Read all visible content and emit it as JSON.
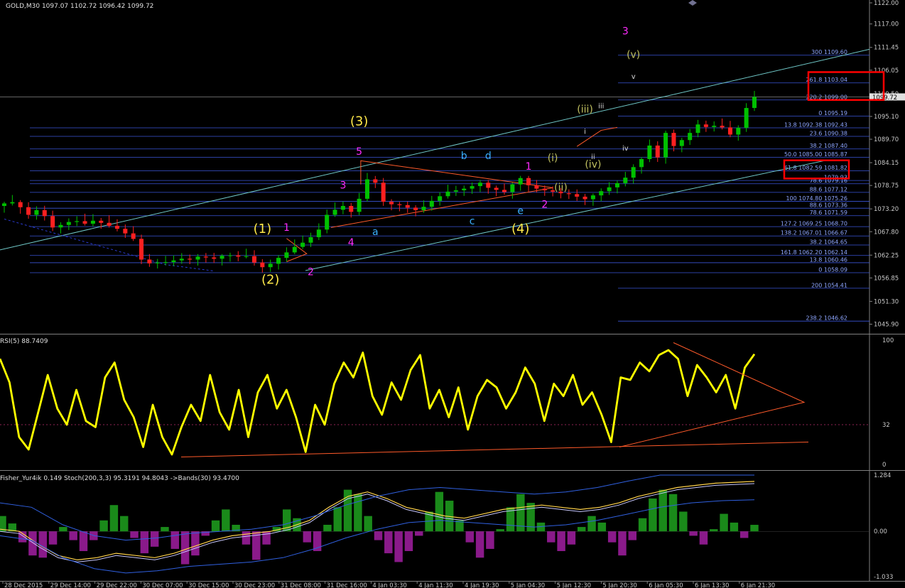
{
  "window": {
    "symbol_header": "GOLD,M30  1097.07 1102.72 1096.42 1099.72"
  },
  "colors": {
    "background": "#000000",
    "grid": "#1e2a55",
    "axis_text": "#c8c8c8",
    "candle_up": "#00c000",
    "candle_down": "#ff2020",
    "fib_line": "#3a55d8",
    "fib_text": "#8ea6ff",
    "channel": "#6fc7c7",
    "triangle": "#ff5a2a",
    "yellow": "#ffe84a",
    "magenta": "#ff2bff",
    "cyan": "#3ab0ff",
    "olive": "#c0c060",
    "white": "#d8d8d8",
    "red_box": "#ff0000",
    "rsi_line": "#ffff00",
    "hist_up": "#1a8a1a",
    "hist_down": "#8a1a8a",
    "stoch_main": "#ffd24a",
    "stoch_signal": "#c8c8ff",
    "bands": "#3060e0"
  },
  "chart_data": [
    {
      "type": "candlestick",
      "title": "GOLD,M30",
      "ohlc_header": {
        "open": 1097.07,
        "high": 1102.72,
        "low": 1096.42,
        "close": 1099.72
      },
      "ylim": [
        1044.3,
        1122.0
      ],
      "y_ticks": [
        1122.0,
        1117.0,
        1111.45,
        1106.05,
        1100.5,
        1095.1,
        1089.7,
        1084.15,
        1078.75,
        1073.2,
        1067.8,
        1062.25,
        1056.85,
        1051.3,
        1045.9
      ],
      "y_tick_labels": [
        "1122.00",
        "1117.00",
        "1111.45",
        "1106.05",
        "1100.50",
        "1095.10",
        "1089.70",
        "1084.15",
        "1078.75",
        "1073.20",
        "1067.80",
        "1062.25",
        "1056.85",
        "1051.30",
        "1045.90"
      ],
      "current_price_label": "1099.72",
      "x_tick_labels": [
        "28 Dec 2015",
        "29 Dec 14:00",
        "29 Dec 22:00",
        "30 Dec 07:00",
        "30 Dec 15:00",
        "30 Dec 23:00",
        "31 Dec 08:00",
        "31 Dec 16:00",
        "4 Jan 03:30",
        "4 Jan 11:30",
        "4 Jan 19:30",
        "5 Jan 04:30",
        "5 Jan 12:30",
        "5 Jan 20:30",
        "6 Jan 05:30",
        "6 Jan 13:30",
        "6 Jan 21:30"
      ],
      "close_path": [
        1074.5,
        1074.8,
        1073.6,
        1071.8,
        1072.9,
        1071.5,
        1068.8,
        1069.4,
        1070.1,
        1070.3,
        1069.7,
        1070.4,
        1069.9,
        1069.2,
        1068.5,
        1067.4,
        1066.1,
        1061.2,
        1060.3,
        1060.5,
        1060.6,
        1061.0,
        1061.4,
        1061.2,
        1061.9,
        1061.7,
        1061.4,
        1062.1,
        1062.2,
        1061.9,
        1062.0,
        1060.5,
        1059.4,
        1060.2,
        1061.6,
        1062.9,
        1064.2,
        1065.2,
        1066.5,
        1068.3,
        1071.8,
        1073.0,
        1073.9,
        1072.5,
        1075.6,
        1080.2,
        1079.4,
        1074.9,
        1074.3,
        1074.1,
        1073.5,
        1072.9,
        1073.7,
        1075.1,
        1076.2,
        1077.3,
        1077.6,
        1078.0,
        1078.6,
        1079.4,
        1078.2,
        1077.7,
        1077.2,
        1079.0,
        1080.5,
        1078.8,
        1078.0,
        1077.6,
        1077.3,
        1076.9,
        1076.7,
        1076.1,
        1075.5,
        1076.4,
        1077.4,
        1078.3,
        1079.3,
        1080.6,
        1083.1,
        1085.0,
        1088.2,
        1085.4,
        1091.2,
        1088.1,
        1089.5,
        1091.2,
        1093.2,
        1092.6,
        1092.9,
        1092.5,
        1090.8,
        1092.4,
        1097.1,
        1099.72
      ],
      "fib_levels": [
        {
          "label": "300 1109.60",
          "value": 1109.6
        },
        {
          "label": "261.8 1103.04",
          "value": 1103.04
        },
        {
          "label": "220.2 1099.00",
          "value": 1099.0
        },
        {
          "label": "0 1095.19",
          "value": 1095.19
        },
        {
          "label": "13.8 1092.38 1092.43",
          "value": 1092.4
        },
        {
          "label": "23.6 1090.38",
          "value": 1090.38
        },
        {
          "label": "38.2 1087.40",
          "value": 1087.4
        },
        {
          "label": "50.0 1085.00 1085.87",
          "value": 1085.4
        },
        {
          "label": "61.8 1082.59 1081.82",
          "value": 1082.2
        },
        {
          "label": "1079.93",
          "value": 1079.93
        },
        {
          "label": "78.6 1079.16",
          "value": 1079.16
        },
        {
          "label": "88.6 1077.12",
          "value": 1077.12
        },
        {
          "label": "100 1074.80 1075.26",
          "value": 1075.0
        },
        {
          "label": "88.6 1073.36",
          "value": 1073.36
        },
        {
          "label": "78.6 1071.59",
          "value": 1071.59
        },
        {
          "label": "127.2 1069.25 1068.70",
          "value": 1069.0
        },
        {
          "label": "138.2 1067.01 1066.67",
          "value": 1066.8
        },
        {
          "label": "38.2 1064.65",
          "value": 1064.65
        },
        {
          "label": "161.8 1062.20 1062.14",
          "value": 1062.17
        },
        {
          "label": "13.8 1060.46",
          "value": 1060.46
        },
        {
          "label": "0 1058.09",
          "value": 1058.09
        },
        {
          "label": "200 1054.41",
          "value": 1054.41
        },
        {
          "label": "238.2 1046.62",
          "value": 1046.62
        }
      ],
      "wave_labels": [
        {
          "text": "(1)",
          "color": "yellow",
          "i": 32,
          "price": 1067.5
        },
        {
          "text": "(2)",
          "color": "yellow",
          "i": 33,
          "price": 1055.5
        },
        {
          "text": "(3)",
          "color": "yellow",
          "i": 44,
          "price": 1093.0
        },
        {
          "text": "(4)",
          "color": "yellow",
          "i": 64,
          "price": 1067.5
        },
        {
          "text": "1",
          "color": "magenta",
          "i": 35,
          "price": 1068.0
        },
        {
          "text": "2",
          "color": "magenta",
          "i": 38,
          "price": 1057.5
        },
        {
          "text": "3",
          "color": "magenta",
          "i": 42,
          "price": 1078.0
        },
        {
          "text": "4",
          "color": "magenta",
          "i": 43,
          "price": 1064.5
        },
        {
          "text": "5",
          "color": "magenta",
          "i": 44,
          "price": 1086.0
        },
        {
          "text": "1",
          "color": "magenta",
          "i": 65,
          "price": 1082.5
        },
        {
          "text": "2",
          "color": "magenta",
          "i": 67,
          "price": 1073.5
        },
        {
          "text": "3",
          "color": "magenta",
          "i": 77,
          "price": 1114.5
        },
        {
          "text": "a",
          "color": "cyan",
          "i": 46,
          "price": 1067.0
        },
        {
          "text": "b",
          "color": "cyan",
          "i": 57,
          "price": 1085.0
        },
        {
          "text": "c",
          "color": "cyan",
          "i": 58,
          "price": 1069.5
        },
        {
          "text": "d",
          "color": "cyan",
          "i": 60,
          "price": 1085.0
        },
        {
          "text": "e",
          "color": "cyan",
          "i": 64,
          "price": 1072.0
        },
        {
          "text": "(i)",
          "color": "olive",
          "i": 68,
          "price": 1084.5
        },
        {
          "text": "(ii)",
          "color": "olive",
          "i": 69,
          "price": 1077.5
        },
        {
          "text": "(iii)",
          "color": "olive",
          "i": 72,
          "price": 1096.0
        },
        {
          "text": "(iv)",
          "color": "olive",
          "i": 73,
          "price": 1083.0
        },
        {
          "text": "(v)",
          "color": "olive",
          "i": 78,
          "price": 1109.0
        },
        {
          "text": "i",
          "color": "white",
          "i": 72,
          "price": 1091.0
        },
        {
          "text": "ii",
          "color": "white",
          "i": 73,
          "price": 1085.0
        },
        {
          "text": "iii",
          "color": "white",
          "i": 74,
          "price": 1097.0
        },
        {
          "text": "iv",
          "color": "white",
          "i": 77,
          "price": 1087.0
        },
        {
          "text": "v",
          "color": "white",
          "i": 78,
          "price": 1104.0
        }
      ]
    },
    {
      "type": "line",
      "title": "RSI(5) 88.7409",
      "ylim": [
        0,
        100
      ],
      "y_ticks": [
        100,
        32,
        0
      ],
      "y_tick_labels": [
        "100",
        "32",
        "0"
      ],
      "level": 32,
      "values": [
        85,
        66,
        22,
        12,
        42,
        72,
        45,
        32,
        60,
        35,
        30,
        70,
        82,
        52,
        38,
        14,
        48,
        22,
        8,
        30,
        48,
        35,
        72,
        42,
        28,
        60,
        22,
        58,
        72,
        45,
        60,
        38,
        10,
        48,
        32,
        65,
        82,
        70,
        90,
        55,
        40,
        66,
        52,
        76,
        88,
        45,
        60,
        38,
        62,
        28,
        55,
        68,
        62,
        45,
        58,
        78,
        65,
        35,
        65,
        55,
        72,
        48,
        58,
        40,
        18,
        70,
        68,
        82,
        75,
        88,
        92,
        85,
        55,
        80,
        70,
        58,
        72,
        45,
        78,
        88.74
      ]
    },
    {
      "type": "bar",
      "title": "Fisher_Yur4ik 0.149  Stoch(200,3,3) 95.3191 94.8043  ->Bands(30) 93.4700",
      "ylim": [
        -1.033,
        1.284
      ],
      "y_ticks": [
        1.284,
        0.0,
        -1.033
      ],
      "y_tick_labels": [
        "1.284",
        "0.00",
        "-1.033"
      ],
      "values": [
        0.35,
        0.18,
        -0.25,
        -0.55,
        -0.6,
        -0.3,
        0.1,
        -0.2,
        -0.45,
        -0.2,
        0.25,
        0.6,
        0.35,
        -0.15,
        -0.5,
        -0.35,
        0.1,
        -0.4,
        -0.75,
        -0.55,
        -0.1,
        0.25,
        0.5,
        0.15,
        -0.3,
        -0.65,
        -0.3,
        0.1,
        0.5,
        0.3,
        -0.25,
        -0.45,
        0.15,
        0.55,
        0.95,
        0.85,
        0.35,
        -0.2,
        -0.5,
        -0.7,
        -0.45,
        -0.1,
        0.45,
        0.9,
        0.7,
        0.25,
        -0.25,
        -0.6,
        -0.4,
        0.05,
        0.55,
        0.85,
        0.65,
        0.2,
        -0.25,
        -0.45,
        -0.3,
        0.1,
        0.35,
        0.2,
        -0.25,
        -0.55,
        -0.2,
        0.3,
        0.75,
        0.95,
        0.85,
        0.45,
        -0.1,
        -0.3,
        0.05,
        0.4,
        0.2,
        -0.15,
        0.149
      ],
      "stoch_values": [
        0.05,
        0.0,
        -0.3,
        -0.55,
        -0.65,
        -0.6,
        -0.5,
        -0.55,
        -0.6,
        -0.5,
        -0.35,
        -0.2,
        -0.1,
        -0.05,
        0.0,
        0.1,
        0.25,
        0.55,
        0.8,
        0.9,
        0.75,
        0.55,
        0.45,
        0.35,
        0.3,
        0.4,
        0.5,
        0.55,
        0.6,
        0.55,
        0.5,
        0.55,
        0.65,
        0.8,
        0.9,
        1.0,
        1.05,
        1.1,
        1.12,
        1.14
      ],
      "bands_values": [
        0.3,
        0.2,
        -0.2,
        -0.45,
        -0.55,
        -0.5,
        -0.4,
        -0.35,
        -0.3,
        -0.2,
        0.0,
        0.25,
        0.45,
        0.6,
        0.65,
        0.6,
        0.55,
        0.5,
        0.55,
        0.65,
        0.8,
        0.95,
        1.05,
        1.1,
        1.12
      ],
      "zero_line": 0.0
    }
  ]
}
